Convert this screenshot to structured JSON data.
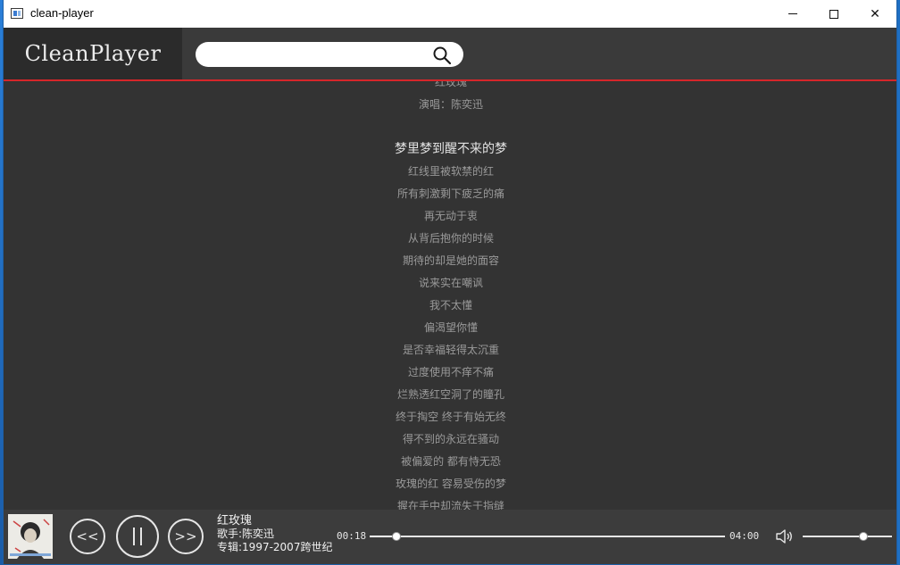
{
  "window": {
    "title": "clean-player",
    "minimize_symbol": "",
    "close_symbol": "✕"
  },
  "header": {
    "logo": "CleanPlayer",
    "search": {
      "value": "",
      "placeholder": ""
    }
  },
  "lyrics": {
    "lines": [
      "红玫瑰",
      "演唱：陈奕迅",
      "",
      "梦里梦到醒不来的梦",
      "红线里被软禁的红",
      "所有刺激剩下疲乏的痛",
      "再无动于衷",
      "从背后抱你的时候",
      "期待的却是她的面容",
      "说来实在嘲讽",
      "我不太懂",
      "偏渴望你懂",
      "是否幸福轻得太沉重",
      "过度使用不痒不痛",
      "烂熟透红空洞了的瞳孔",
      "终于掏空 终于有始无终",
      "得不到的永远在骚动",
      "被偏爱的 都有恃无恐",
      "玫瑰的红 容易受伤的梦",
      "握在手中却流失于指缝"
    ],
    "current_index": 3
  },
  "player": {
    "prev_label": "<<",
    "next_label": ">>",
    "song_title": "红玫瑰",
    "artist": "歌手:陈奕迅",
    "album": "专辑:1997-2007跨世纪",
    "current_time": "00:18",
    "total_time": "04:00",
    "progress": 0.075,
    "volume": 0.68
  },
  "colors": {
    "accent_line": "#d6262a",
    "background": "#333333",
    "header": "#3a3a3a"
  }
}
